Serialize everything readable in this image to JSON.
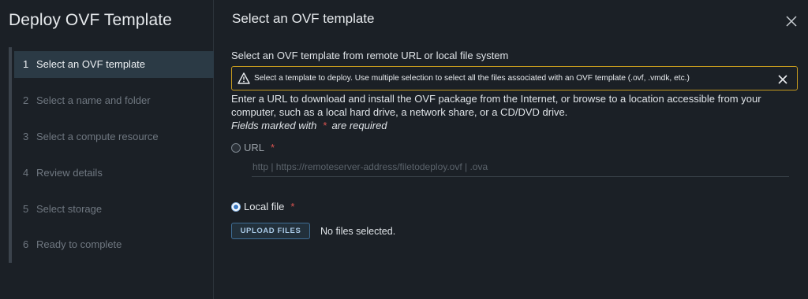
{
  "dialog": {
    "title": "Deploy OVF Template"
  },
  "steps": [
    {
      "num": "1",
      "label": "Select an OVF template"
    },
    {
      "num": "2",
      "label": "Select a name and folder"
    },
    {
      "num": "3",
      "label": "Select a compute resource"
    },
    {
      "num": "4",
      "label": "Review details"
    },
    {
      "num": "5",
      "label": "Select storage"
    },
    {
      "num": "6",
      "label": "Ready to complete"
    }
  ],
  "active_step": 1,
  "page": {
    "title": "Select an OVF template",
    "subtitle": "Select an OVF template from remote URL or local file system",
    "alert": "Select a template to deploy. Use multiple selection to select all the files associated with an OVF template (.ovf, .vmdk, etc.)",
    "description": "Enter a URL to download and install the OVF package from the Internet, or browse to a location accessible from your computer, such as a local hard drive, a network share, or a CD/DVD drive.",
    "required_note_before": "Fields marked with",
    "required_star": "*",
    "required_note_after": "are required"
  },
  "source": {
    "url_label": "URL",
    "url_placeholder": "http | https://remoteserver-address/filetodeploy.ovf | .ova",
    "url_value": "",
    "local_label": "Local file",
    "selected": "local",
    "upload_button": "UPLOAD FILES",
    "files_status": "No files selected."
  },
  "colors": {
    "background": "#1b2026",
    "active_step": "#2b3a45",
    "warning_border": "#c59a1e",
    "required_star": "#d9534f",
    "radio_accent": "#3b7ac3",
    "button_border": "#3f6e96"
  },
  "icons": {
    "close": "close-icon",
    "warning": "warning-triangle-icon",
    "alert_close": "close-icon"
  }
}
